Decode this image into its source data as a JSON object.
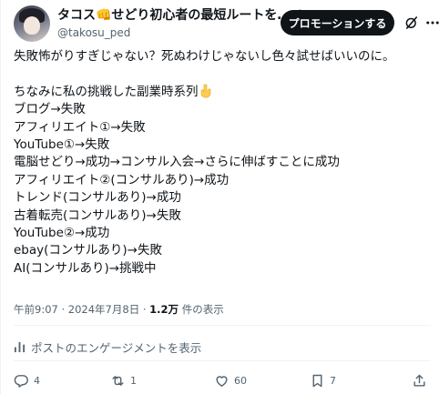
{
  "author": {
    "display_name": "タコス👊せどり初心者の最短ルートを…",
    "handle": "@takosu_ped"
  },
  "header": {
    "promote_label": "プロモーションする"
  },
  "tweet": {
    "lines": [
      "失敗怖がりすぎじゃない？死ぬわけじゃないし色々試せばいいのに。",
      "",
      "ちなみに私の挑戦した副業時系列",
      "ブログ→失敗",
      "アフィリエイト①→失敗",
      "YouTube①→失敗",
      "電脳せどり→成功→コンサル入会→さらに伸ばすことに成功",
      "アフィリエイト②(コンサルあり)→成功",
      "トレンド(コンサルあり)→成功",
      "古着転売(コンサルあり)→失敗",
      "YouTube②→成功",
      "ebay(コンサルあり)→失敗",
      "AI(コンサルあり)→挑戦中"
    ]
  },
  "meta": {
    "timestamp": "午前9:07 · 2024年7月8日 · ",
    "views_count": "1.2万",
    "views_label": " 件の表示"
  },
  "engagement": {
    "label": "ポストのエンゲージメントを表示"
  },
  "actions": {
    "replies": "4",
    "reposts": "1",
    "likes": "60",
    "bookmarks": "7"
  },
  "colors": {
    "text": "#0f1419",
    "secondary": "#536471",
    "verified": "#1d9bf0",
    "button_bg": "#0f1419",
    "divider": "#eff3f4"
  },
  "icons": [
    "verified-badge-icon",
    "grok-icon",
    "more-icon",
    "pointing-down-emoji-icon",
    "analytics-icon",
    "reply-icon",
    "repost-icon",
    "like-icon",
    "bookmark-icon",
    "share-icon"
  ]
}
